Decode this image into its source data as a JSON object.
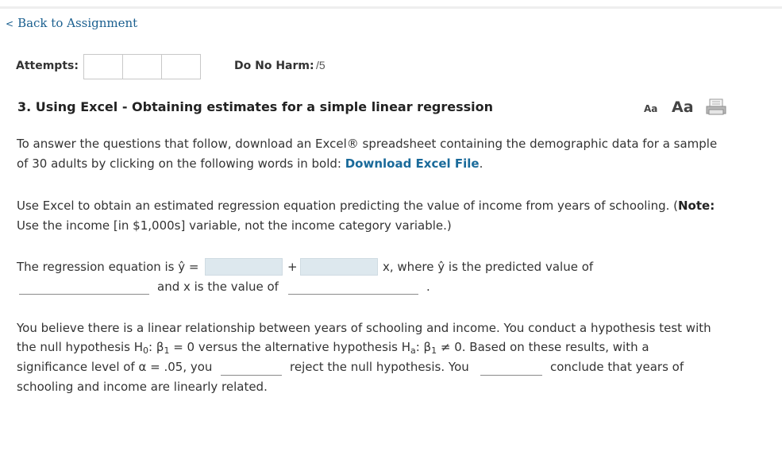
{
  "nav": {
    "back_arrow": "<",
    "back_label": "Back to Assignment"
  },
  "attempts": {
    "label": "Attempts:",
    "boxes": 3
  },
  "harm": {
    "label": "Do No Harm:",
    "score": "/5"
  },
  "question": {
    "title": "3.  Using Excel - Obtaining estimates for a simple linear regression",
    "font_small": "Aa",
    "font_large": "Aa",
    "print_icon": "printer-icon"
  },
  "para1": {
    "text_before": "To answer the questions that follow, download an Excel® spreadsheet containing the demographic data for a sample of 30 adults by clicking on the following words in bold: ",
    "link": "Download Excel File",
    "text_after": "."
  },
  "para2": {
    "text_before": "Use Excel to obtain an estimated regression equation predicting the value of income from years of schooling. (",
    "note_label": "Note:",
    "text_after": " Use the income [in $1,000s] variable, not the income category variable.)"
  },
  "regression": {
    "prefix": "The regression equation is ŷ =",
    "plus": "+",
    "mid": "x, where ŷ is the predicted value of",
    "line2_mid": "and x is the value of",
    "period": "."
  },
  "para3": {
    "line1": "You believe there is a linear relationship between years of schooling and income. You conduct a hypothesis test with",
    "line2_a": "the null hypothesis H",
    "line2_sub0": "0",
    "line2_b": ": β",
    "line2_sub1": "1",
    "line2_c": " = 0 versus the alternative hypothesis H",
    "line2_suba": "a",
    "line2_d": ": β",
    "line2_sub2": "1",
    "line2_e": " ≠ 0. Based on these results, with a",
    "line3_a": "significance level of α = .05, you",
    "line3_b": "reject the null hypothesis. You",
    "line3_c": "conclude that years of",
    "line4": "schooling and income are linearly related."
  }
}
